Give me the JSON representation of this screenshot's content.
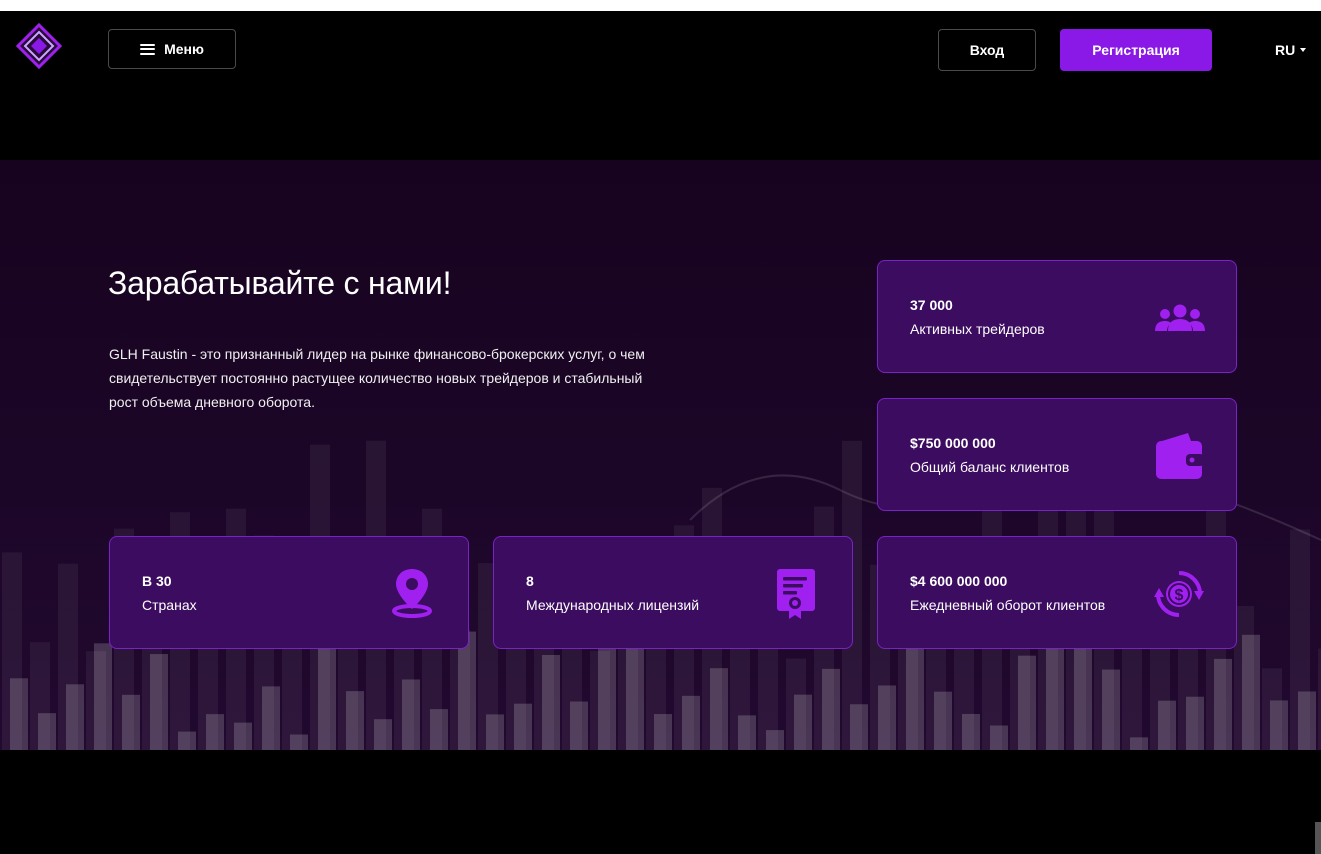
{
  "header": {
    "menu_label": "Меню",
    "login_label": "Вход",
    "register_label": "Регистрация",
    "language": "RU"
  },
  "hero": {
    "title": "Зарабатывайте с нами!",
    "description": "GLH Faustin - это признанный лидер на рынке финансово-брокерских услуг, о чем свидетельствует постоянно растущее количество новых трейдеров и стабильный рост объема дневного оборота."
  },
  "stats": [
    {
      "value": "37 000",
      "label": "Активных трейдеров",
      "icon": "users-icon"
    },
    {
      "value": "$750 000 000",
      "label": "Общий баланс клиентов",
      "icon": "wallet-icon"
    },
    {
      "value": "В 30",
      "label": "Странах",
      "icon": "map-pin-icon"
    },
    {
      "value": "8",
      "label": "Международных лицензий",
      "icon": "certificate-icon"
    },
    {
      "value": "$4 600 000 000",
      "label": "Ежедневный оборот клиентов",
      "icon": "money-exchange-icon"
    }
  ],
  "colors": {
    "accent": "#8a18e6",
    "card_background": "#3b0c5f",
    "card_border": "#7a22c8",
    "icon": "#a020f0",
    "background": "#000000"
  }
}
